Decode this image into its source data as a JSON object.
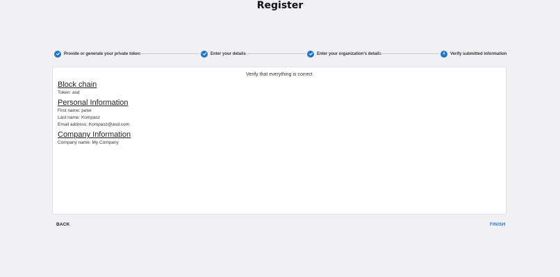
{
  "page": {
    "title": "Register"
  },
  "stepper": {
    "steps": [
      {
        "label": "Provide or generate your private token",
        "status": "completed",
        "icon": "check-icon"
      },
      {
        "label": "Enter your details",
        "status": "completed",
        "icon": "check-icon"
      },
      {
        "label": "Enter your organization's details",
        "status": "completed",
        "icon": "check-icon"
      },
      {
        "label": "Verify submitted information",
        "status": "active",
        "number": "4"
      }
    ],
    "accent_color": "#1f75c9"
  },
  "card": {
    "verify_text": "Verify that everything is correct",
    "sections": {
      "blockchain": {
        "heading": "Block chain",
        "token_line": "Token: asd"
      },
      "personal": {
        "heading": "Personal Information",
        "first_name_line": "First name: peter",
        "last_name_line": "Last name: Kompasz",
        "email_line": "Email address: Kompasz@asd.com"
      },
      "company": {
        "heading": "Company Information",
        "company_name_line": "Company name: My Company"
      }
    }
  },
  "actions": {
    "back_label": "BACK",
    "finish_label": "FINISH"
  }
}
